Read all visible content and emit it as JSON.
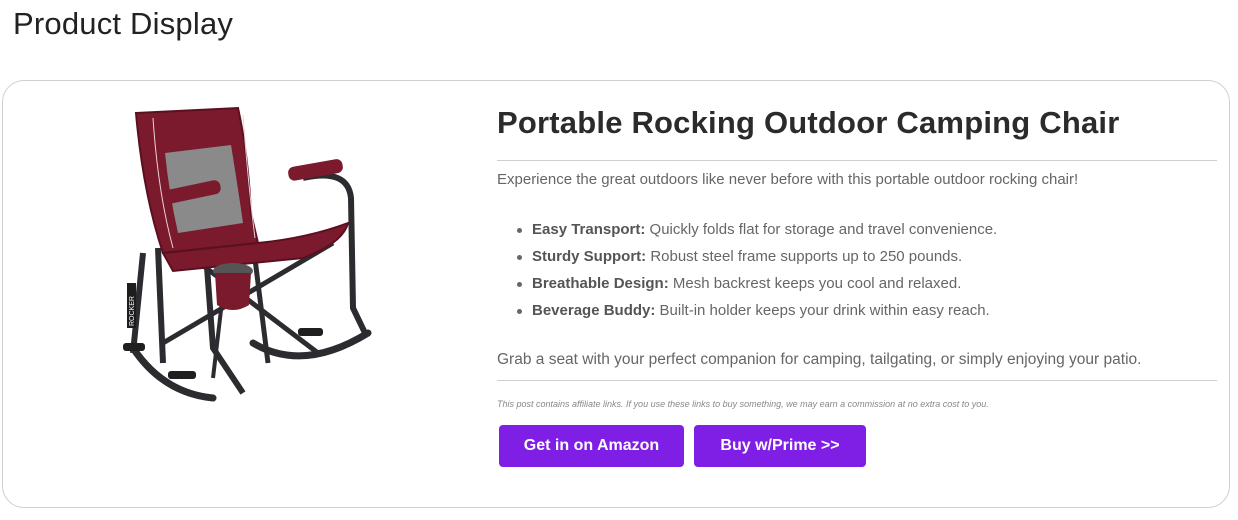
{
  "page": {
    "title": "Product Display"
  },
  "product": {
    "title": "Portable Rocking Outdoor Camping Chair",
    "image_alt": "rocking-chair-image",
    "intro": "Experience the great outdoors like never before with this portable outdoor rocking chair!",
    "features": [
      {
        "label": "Easy Transport:",
        "text": " Quickly folds flat for storage and travel convenience."
      },
      {
        "label": "Sturdy Support:",
        "text": " Robust steel frame supports up to 250 pounds."
      },
      {
        "label": "Breathable Design:",
        "text": " Mesh backrest keeps you cool and relaxed."
      },
      {
        "label": "Beverage Buddy:",
        "text": " Built-in holder keeps your drink within easy reach."
      }
    ],
    "closing": "Grab a seat with your perfect companion for camping, tailgating, or simply enjoying your patio.",
    "disclaimer": "This post contains affiliate links. If you use these links to buy something, we may earn a commission at no extra cost to you.",
    "chair_logo_text": "ROCKER"
  },
  "buttons": {
    "amazon_label": "Get in on Amazon",
    "prime_label": "Buy w/Prime >>"
  },
  "colors": {
    "button_bg": "#7f1fe6",
    "chair_fabric": "#7a1a2c",
    "chair_mesh": "#8a8a8a",
    "frame": "#2c2c30"
  }
}
